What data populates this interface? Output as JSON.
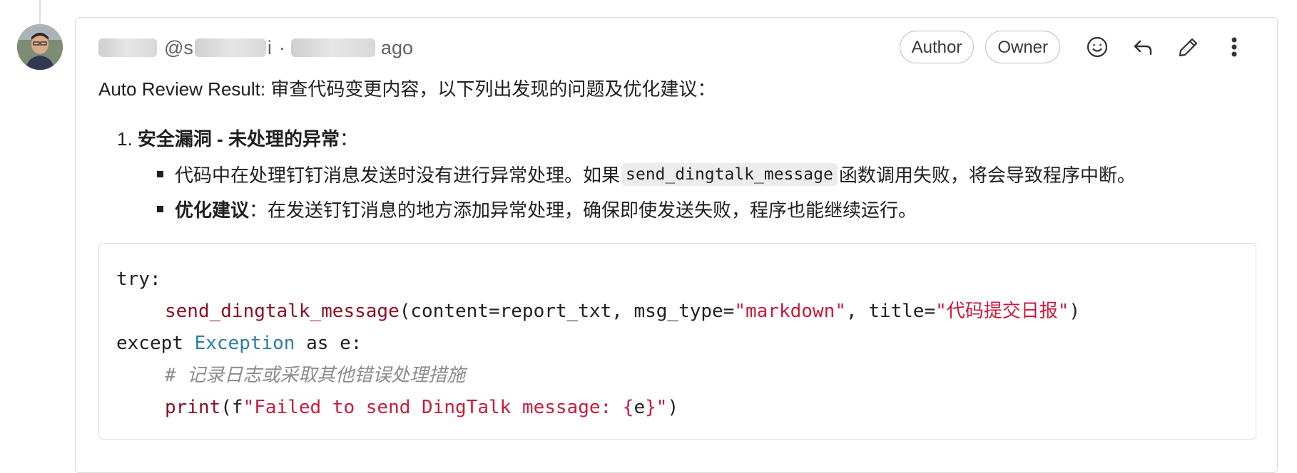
{
  "comment": {
    "header_text": "ago",
    "header_handle_prefix": "@s",
    "header_sep_i": "i",
    "header_dot": "·",
    "badges": [
      "Author",
      "Owner"
    ],
    "icons": [
      "smiley-icon",
      "reply-icon",
      "pencil-icon",
      "more-vertical-icon"
    ],
    "intro": "Auto Review Result: 审查代码变更内容，以下列出发现的问题及优化建议：",
    "issue_number": "1.",
    "issue_title": "安全漏洞 - 未处理的异常",
    "issue_colon": "：",
    "bullet1_before": "代码中在处理钉钉消息发送时没有进行异常处理。如果",
    "bullet1_code": "send_dingtalk_message",
    "bullet1_after": "函数调用失败，将会导致程序中断。",
    "bullet2_label": "优化建议",
    "bullet2_text": "：在发送钉钉消息的地方添加异常处理，确保即使发送失败，程序也能继续运行。"
  },
  "code": {
    "l1": "try:",
    "l2_fn": "send_dingtalk_message",
    "l2_a": "(content=report_txt, msg_type=",
    "l2_s1": "\"markdown\"",
    "l2_b": ", title=",
    "l2_s2": "\"代码提交日报\"",
    "l2_c": ")",
    "l3_kw": "except ",
    "l3_cls": "Exception",
    "l3_rest": " as e:",
    "l4": "# 记录日志或采取其他错误处理措施",
    "l5_fn": "print",
    "l5_a": "(f",
    "l5_s1": "\"Failed to send DingTalk message: {",
    "l5_e": "e",
    "l5_s2": "}\"",
    "l5_c": ")"
  }
}
